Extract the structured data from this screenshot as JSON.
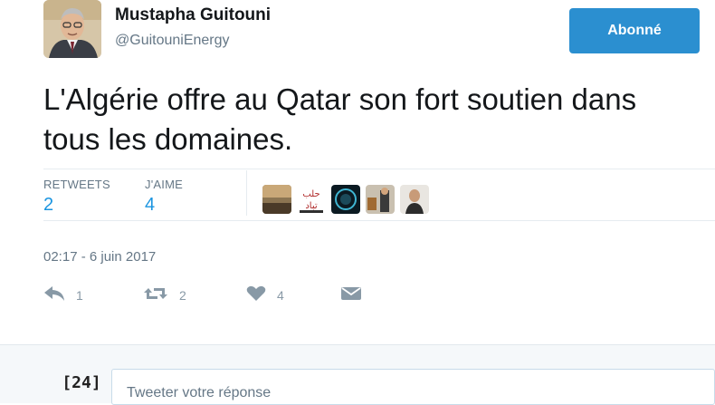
{
  "header": {
    "name": "Mustapha Guitouni",
    "handle": "@GuitouniEnergy",
    "follow_label": "Abonné",
    "accent_color": "#2b8fd0"
  },
  "tweet": {
    "line1": "L'Algérie offre au Qatar son fort soutien dans",
    "line2": "tous les domaines."
  },
  "stats": {
    "retweets_label": "RETWEETS",
    "retweets_value": "2",
    "likes_label": "J'AIME",
    "likes_value": "4",
    "liker_badge_text": "حلب\nتباد"
  },
  "timestamp": "02:17 - 6 juin 2017",
  "actions": {
    "reply_icon": "reply-icon",
    "reply_count": "1",
    "retweet_icon": "retweet-icon",
    "retweet_count": "2",
    "like_icon": "heart-icon",
    "like_count": "4",
    "dm_icon": "envelope-icon"
  },
  "reply_box": {
    "avatar_text": "[24]",
    "placeholder": "Tweeter votre réponse"
  }
}
